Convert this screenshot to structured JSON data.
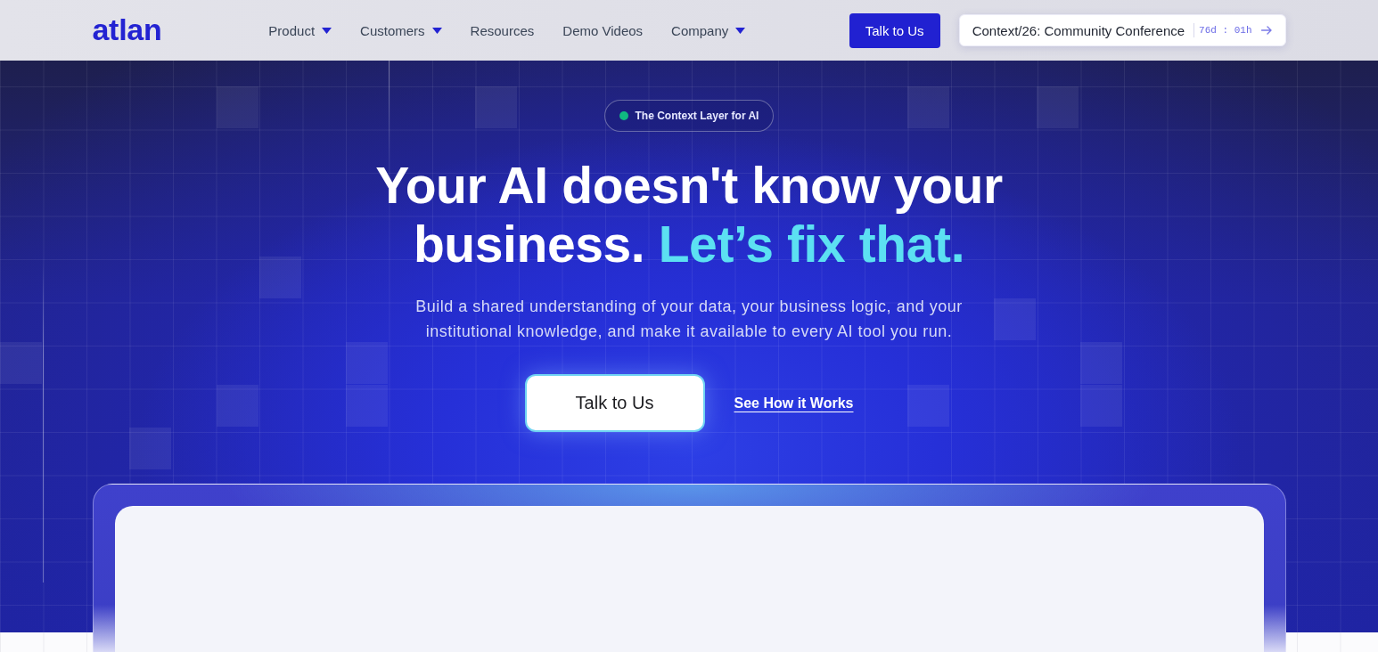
{
  "header": {
    "logo": "atlan",
    "nav": [
      {
        "label": "Product",
        "dropdown": true
      },
      {
        "label": "Customers",
        "dropdown": true
      },
      {
        "label": "Resources",
        "dropdown": false
      },
      {
        "label": "Demo Videos",
        "dropdown": false
      },
      {
        "label": "Company",
        "dropdown": true
      }
    ],
    "cta": "Talk to Us",
    "event": {
      "title": "Context/26: Community Conference",
      "countdown": "76d : 01h"
    }
  },
  "hero": {
    "badge": "The Context Layer for AI",
    "heading": "Your AI doesn't know your business.",
    "heading_highlight": "Let’s fix that.",
    "subtitle": "Build a shared understanding of your data, your business logic, and your institutional knowledge, and make it available to every AI tool you run.",
    "primary_button": "Talk to Us",
    "secondary_link": "See How it Works"
  }
}
